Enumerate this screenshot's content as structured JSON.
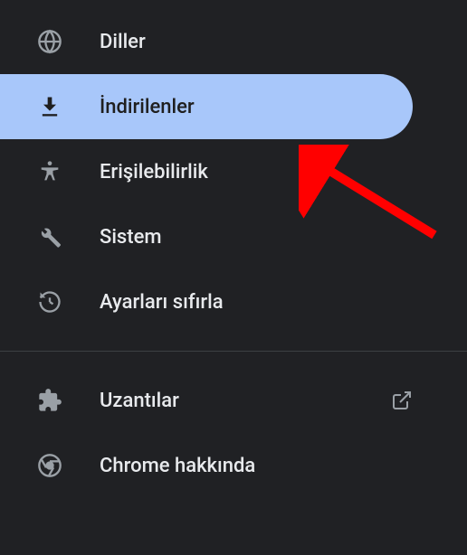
{
  "sidebar": {
    "items": [
      {
        "label": "Diller",
        "icon": "globe-icon",
        "selected": false
      },
      {
        "label": "İndirilenler",
        "icon": "download-icon",
        "selected": true
      },
      {
        "label": "Erişilebilirlik",
        "icon": "accessibility-icon",
        "selected": false
      },
      {
        "label": "Sistem",
        "icon": "wrench-icon",
        "selected": false
      },
      {
        "label": "Ayarları sıfırla",
        "icon": "reset-icon",
        "selected": false
      }
    ],
    "footerItems": [
      {
        "label": "Uzantılar",
        "icon": "extension-icon",
        "external": true
      },
      {
        "label": "Chrome hakkında",
        "icon": "chrome-icon",
        "external": false
      }
    ]
  }
}
